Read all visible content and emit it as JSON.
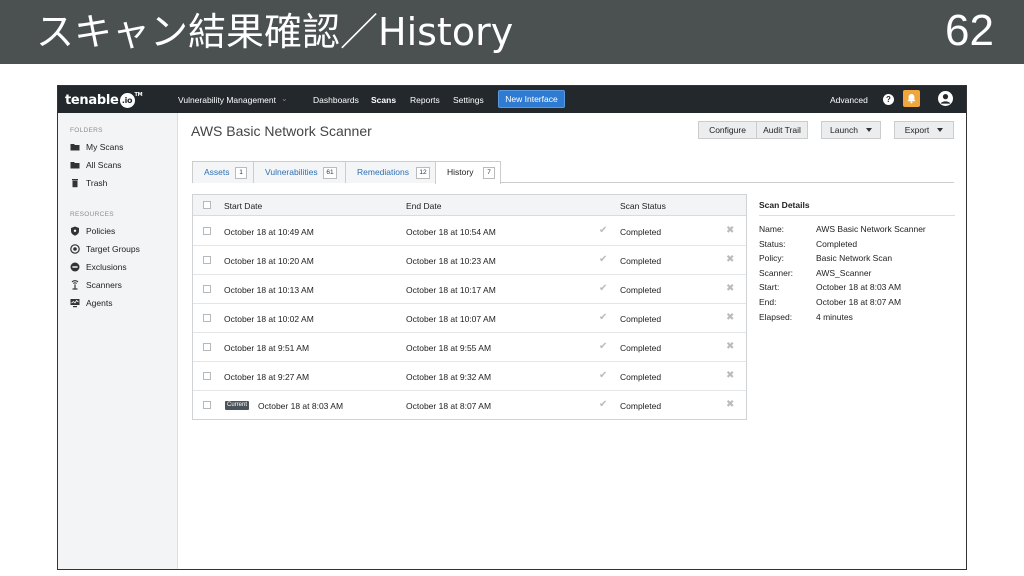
{
  "slide": {
    "title": "スキャン結果確認／History",
    "page_number": "62"
  },
  "topnav": {
    "logo": "tenable",
    "logo_badge": ".io",
    "logo_tm": "TM",
    "product": "Vulnerability Management",
    "items": [
      "Dashboards",
      "Scans",
      "Reports",
      "Settings"
    ],
    "new_interface": "New Interface",
    "advanced": "Advanced",
    "help": "?"
  },
  "sidebar": {
    "folders_label": "FOLDERS",
    "folders": [
      {
        "label": "My Scans",
        "icon": "folder-icon"
      },
      {
        "label": "All Scans",
        "icon": "folder-icon"
      },
      {
        "label": "Trash",
        "icon": "trash-icon"
      }
    ],
    "resources_label": "RESOURCES",
    "resources": [
      {
        "label": "Policies",
        "icon": "shield-icon"
      },
      {
        "label": "Target Groups",
        "icon": "target-icon"
      },
      {
        "label": "Exclusions",
        "icon": "exclusion-icon"
      },
      {
        "label": "Scanners",
        "icon": "scanner-icon"
      },
      {
        "label": "Agents",
        "icon": "agent-icon"
      }
    ]
  },
  "main": {
    "title": "AWS Basic Network Scanner",
    "toolbar": {
      "configure": "Configure",
      "audit_trail": "Audit Trail",
      "launch": "Launch",
      "export": "Export"
    },
    "tabs": [
      {
        "label": "Assets",
        "count": "1"
      },
      {
        "label": "Vulnerabilities",
        "count": "61"
      },
      {
        "label": "Remediations",
        "count": "12"
      },
      {
        "label": "History",
        "count": "7"
      }
    ],
    "table": {
      "headers": {
        "start": "Start Date",
        "end": "End Date",
        "status": "Scan Status"
      },
      "current_badge": "Current",
      "rows": [
        {
          "start": "October 18 at 10:49 AM",
          "end": "October 18 at 10:54 AM",
          "status": "Completed"
        },
        {
          "start": "October 18 at 10:20 AM",
          "end": "October 18 at 10:23 AM",
          "status": "Completed"
        },
        {
          "start": "October 18 at 10:13 AM",
          "end": "October 18 at 10:17 AM",
          "status": "Completed"
        },
        {
          "start": "October 18 at 10:02 AM",
          "end": "October 18 at 10:07 AM",
          "status": "Completed"
        },
        {
          "start": "October 18 at 9:51 AM",
          "end": "October 18 at 9:55 AM",
          "status": "Completed"
        },
        {
          "start": "October 18 at 9:27 AM",
          "end": "October 18 at 9:32 AM",
          "status": "Completed"
        },
        {
          "start": "October 18 at 8:03 AM",
          "end": "October 18 at 8:07 AM",
          "status": "Completed"
        }
      ]
    },
    "details": {
      "title": "Scan Details",
      "fields": [
        {
          "k": "Name:",
          "v": "AWS Basic Network Scanner"
        },
        {
          "k": "Status:",
          "v": "Completed"
        },
        {
          "k": "Policy:",
          "v": "Basic Network Scan"
        },
        {
          "k": "Scanner:",
          "v": "AWS_Scanner"
        },
        {
          "k": "Start:",
          "v": "October 18 at 8:03 AM"
        },
        {
          "k": "End:",
          "v": "October 18 at 8:07 AM"
        },
        {
          "k": "Elapsed:",
          "v": "4 minutes"
        }
      ]
    }
  },
  "colors": {
    "slide_header": "#4b5050",
    "topnav": "#23282c",
    "accent_blue": "#2f7bd2",
    "notification": "#f0a63a"
  }
}
